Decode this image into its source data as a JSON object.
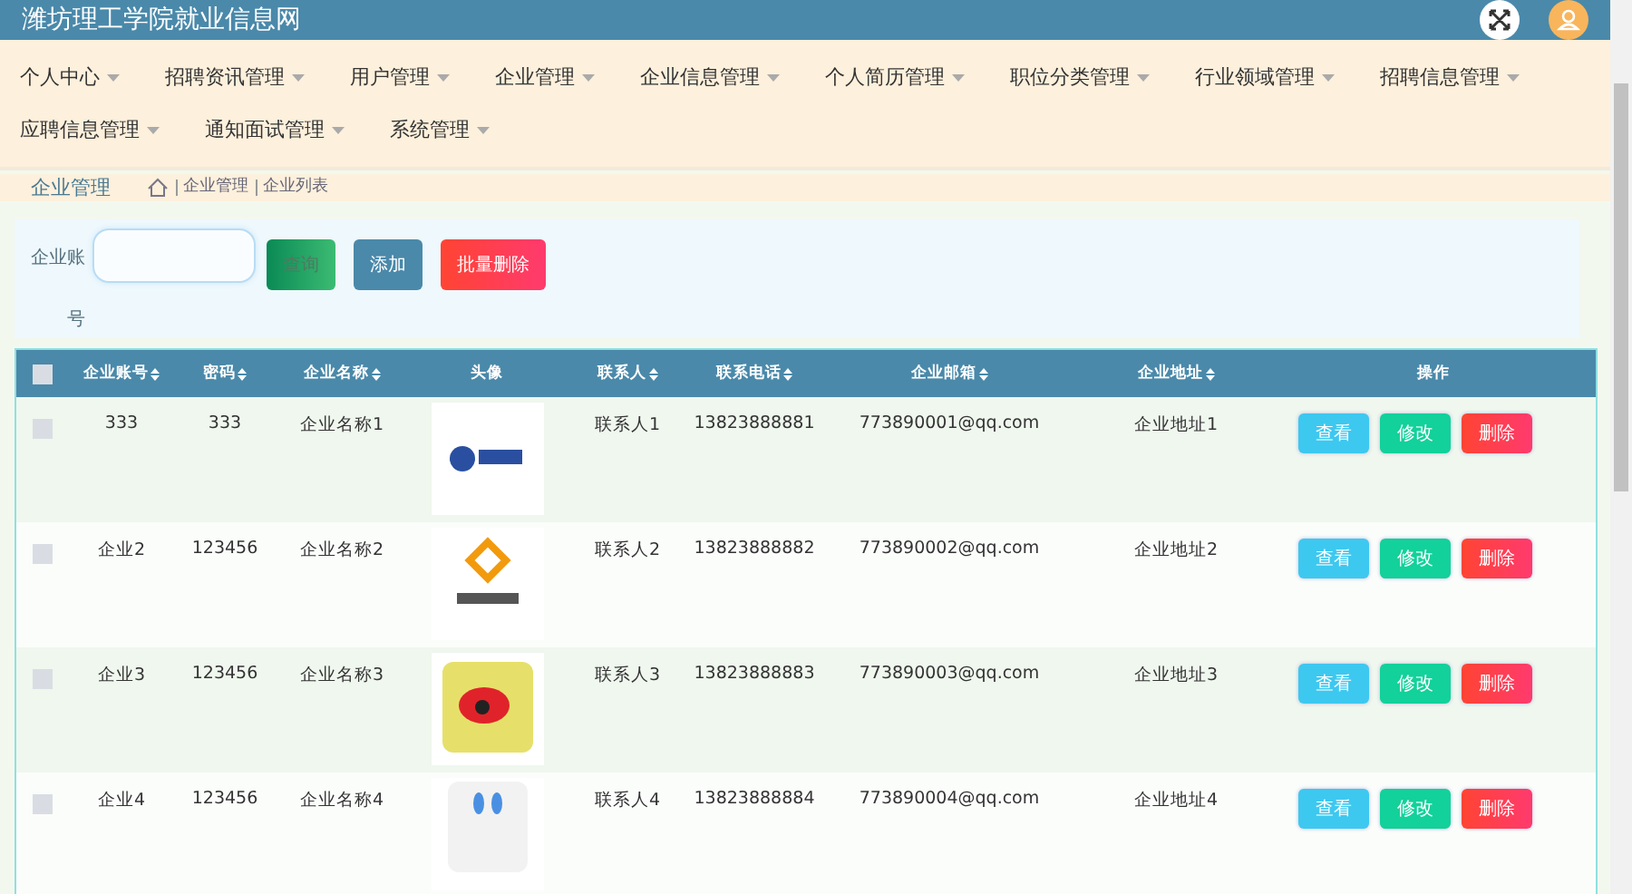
{
  "header": {
    "title": "潍坊理工学院就业信息网"
  },
  "nav": {
    "items": [
      {
        "label": "个人中心"
      },
      {
        "label": "招聘资讯管理"
      },
      {
        "label": "用户管理"
      },
      {
        "label": "企业管理"
      },
      {
        "label": "企业信息管理"
      },
      {
        "label": "个人简历管理"
      },
      {
        "label": "职位分类管理"
      },
      {
        "label": "行业领域管理"
      },
      {
        "label": "招聘信息管理"
      },
      {
        "label": "应聘信息管理"
      },
      {
        "label": "通知面试管理"
      },
      {
        "label": "系统管理"
      }
    ]
  },
  "breadcrumb": {
    "title": "企业管理",
    "path": [
      "企业管理",
      "企业列表"
    ]
  },
  "search": {
    "label": "企业账号",
    "buttons": [
      {
        "label": "查询",
        "kind": "search"
      },
      {
        "label": "添加",
        "kind": "add"
      },
      {
        "label": "批量删除",
        "kind": "delete"
      }
    ]
  },
  "table": {
    "select_all_checked": false,
    "columns": [
      {
        "label": "企业账号",
        "sortable": true
      },
      {
        "label": "密码",
        "sortable": true
      },
      {
        "label": "企业名称",
        "sortable": true
      },
      {
        "label": "头像",
        "sortable": false,
        "kind": "image"
      },
      {
        "label": "联系人",
        "sortable": true
      },
      {
        "label": "联系电话",
        "sortable": true
      },
      {
        "label": "企业邮箱",
        "sortable": true
      },
      {
        "label": "企业地址",
        "sortable": true
      },
      {
        "label": "操作",
        "sortable": false
      }
    ],
    "rows": [
      {
        "checked": false,
        "cells": [
          "333",
          "333",
          "企业名称1",
          "",
          "联系人1",
          "13823888881",
          "773890001@qq.com",
          "企业地址1"
        ],
        "actions": [
          "查看",
          "修改",
          "删除"
        ]
      },
      {
        "checked": false,
        "cells": [
          "企业2",
          "123456",
          "企业名称2",
          "",
          "联系人2",
          "13823888882",
          "773890002@qq.com",
          "企业地址2"
        ],
        "actions": [
          "查看",
          "修改",
          "删除"
        ]
      },
      {
        "checked": false,
        "cells": [
          "企业3",
          "123456",
          "企业名称3",
          "",
          "联系人3",
          "13823888883",
          "773890003@qq.com",
          "企业地址3"
        ],
        "actions": [
          "查看",
          "修改",
          "删除"
        ]
      },
      {
        "checked": false,
        "cells": [
          "企业4",
          "123456",
          "企业名称4",
          "",
          "联系人4",
          "13823888884",
          "773890004@qq.com",
          "企业地址4"
        ],
        "actions": [
          "查看",
          "修改",
          "删除"
        ]
      }
    ]
  }
}
